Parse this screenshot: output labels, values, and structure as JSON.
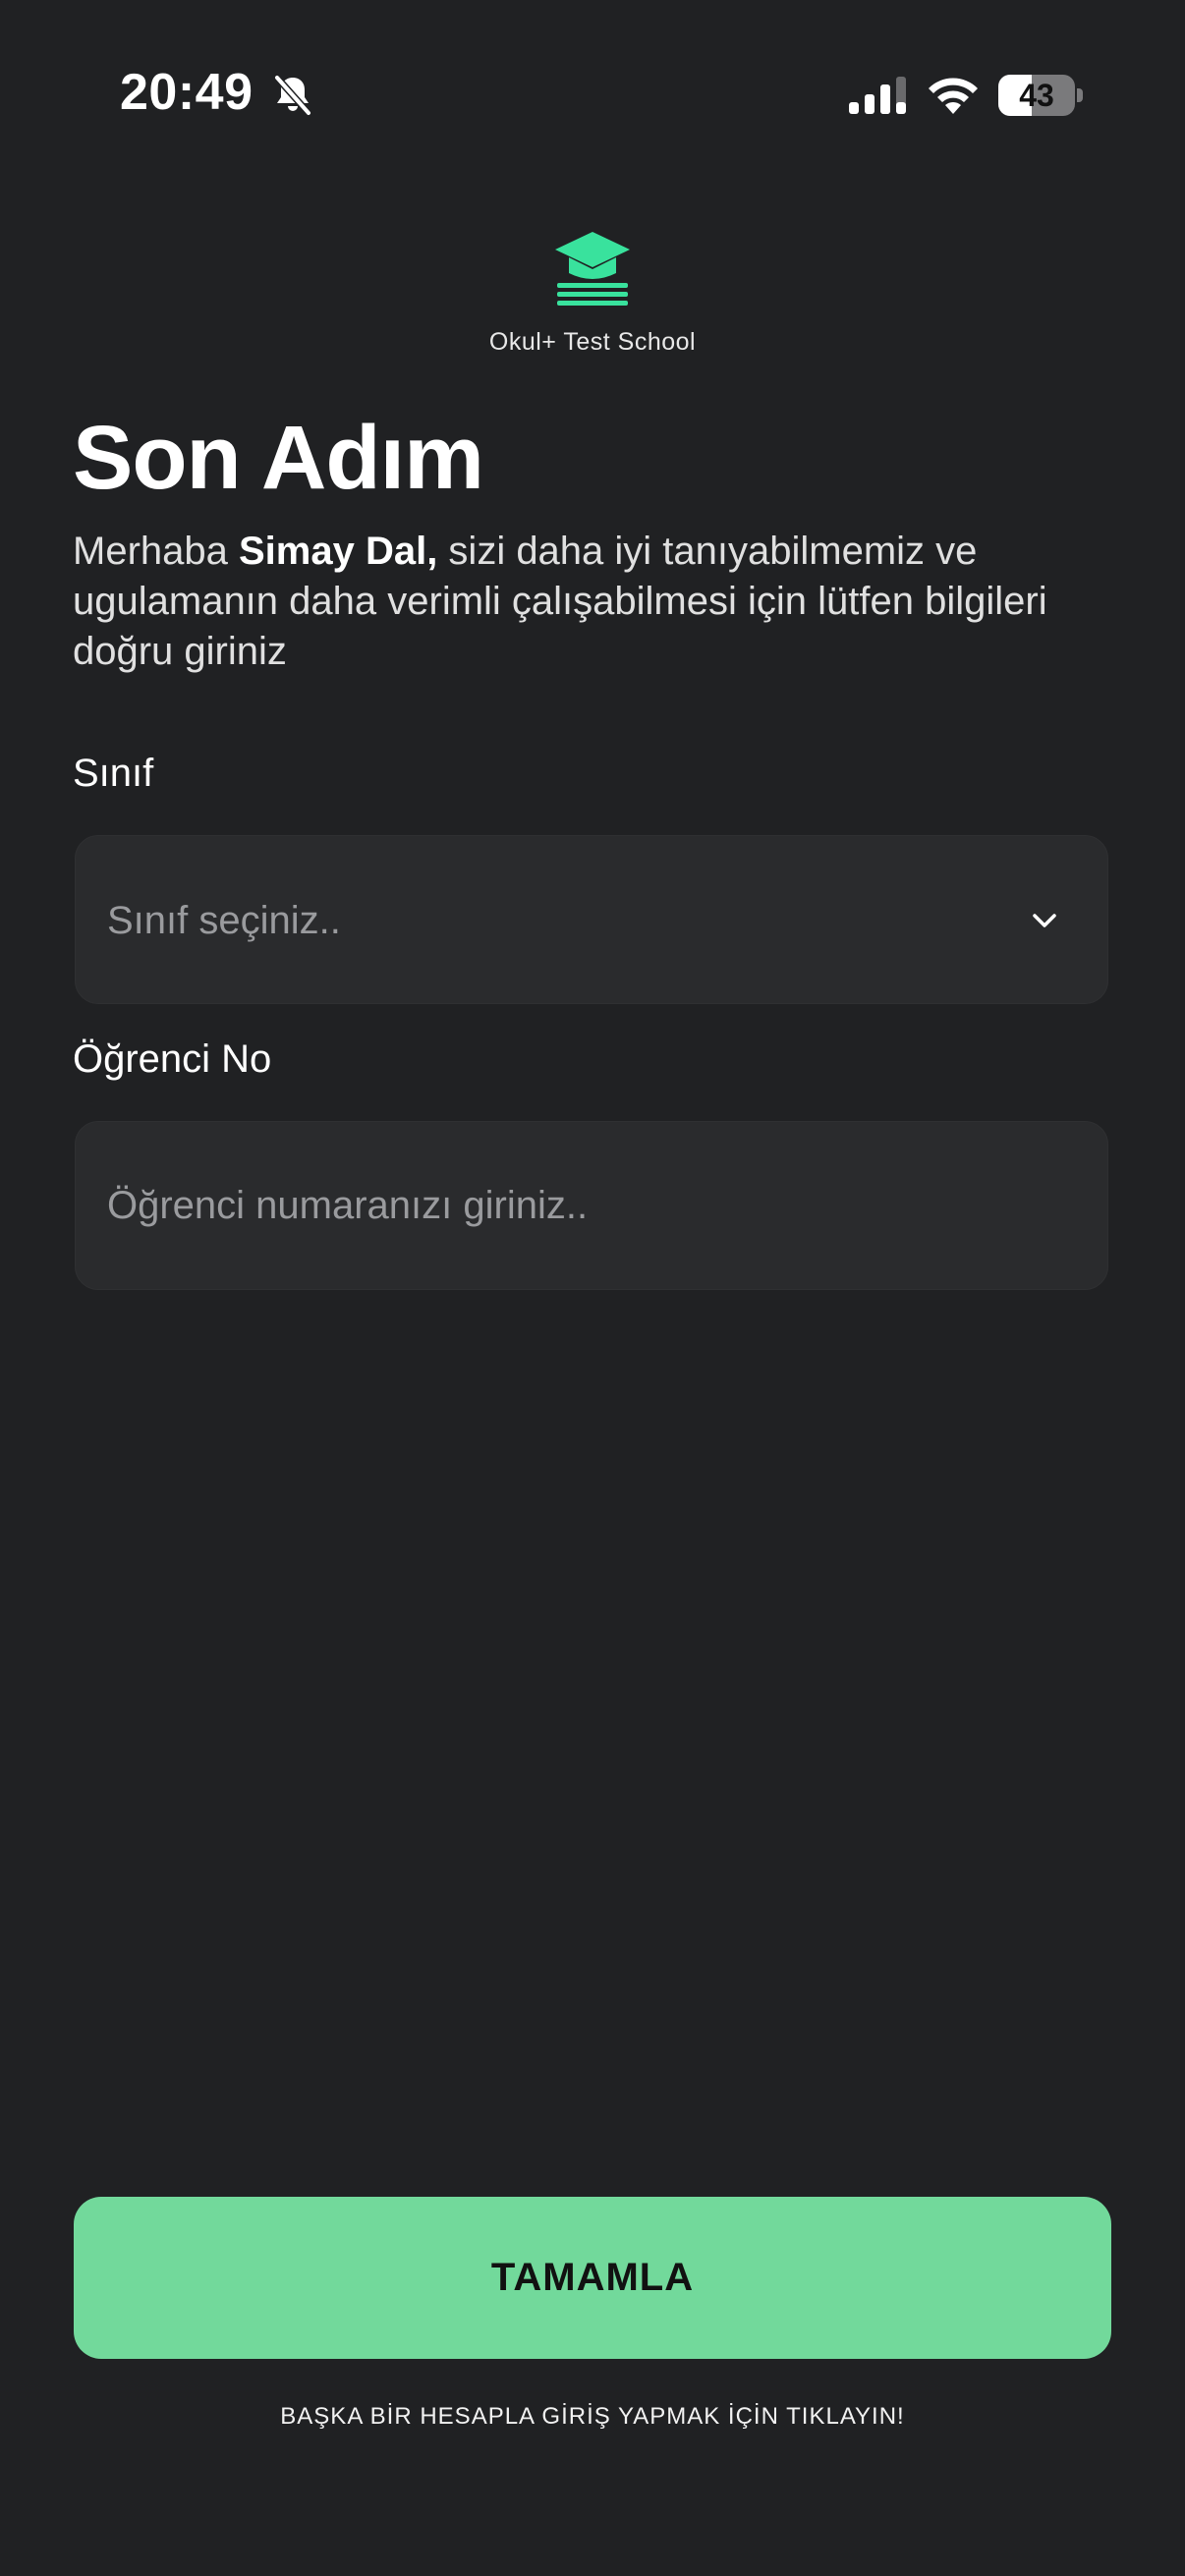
{
  "status_bar": {
    "time": "20:49",
    "battery_level": "43",
    "battery_fraction": 0.43,
    "icons": [
      "bell-slash-icon",
      "cellular-signal-icon",
      "wifi-icon",
      "battery-icon"
    ]
  },
  "branding": {
    "logo_icon": "graduation-cap-icon",
    "school_name": "Okul+ Test School",
    "accent_color": "#39e29d"
  },
  "header": {
    "title": "Son Adım",
    "intro_prefix": "Merhaba ",
    "user_name": "Simay Dal,",
    "intro_suffix": " sizi daha iyi tanıyabilmemiz ve ugulamanın daha verimli çalışabilmesi için lütfen bilgileri doğru giriniz"
  },
  "form": {
    "class_field": {
      "label": "Sınıf",
      "placeholder": "Sınıf seçiniz..",
      "icon": "chevron-down-icon"
    },
    "student_no_field": {
      "label": "Öğrenci No",
      "placeholder": "Öğrenci numaranızı giriniz.."
    }
  },
  "actions": {
    "submit_label": "TAMAMLA",
    "submit_color": "#72d99b",
    "switch_account_label": "BAŞKA BİR HESAPLA GİRİŞ YAPMAK İÇİN TIKLAYIN!"
  },
  "colors": {
    "background": "#202123",
    "field_background": "#2a2b2d"
  }
}
